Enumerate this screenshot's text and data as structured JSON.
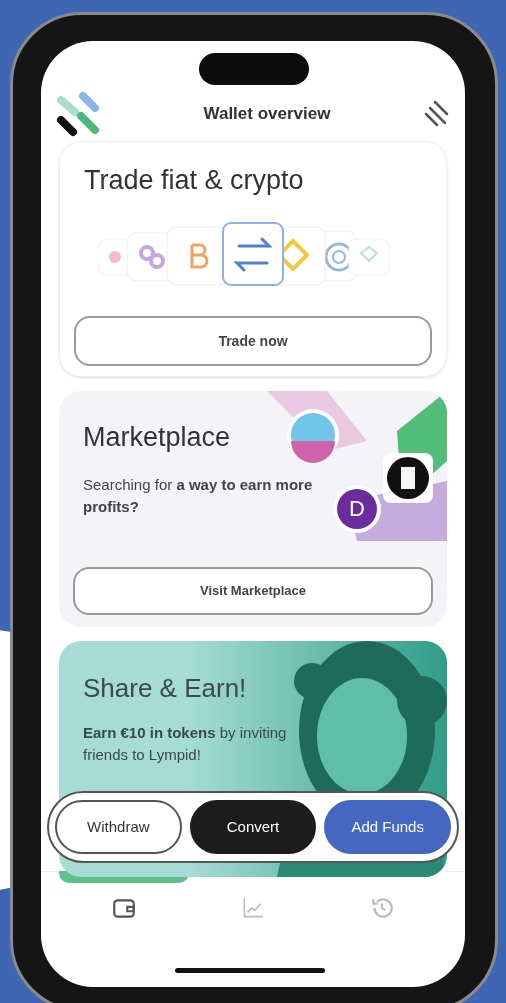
{
  "header": {
    "title": "Wallet overview"
  },
  "trade_card": {
    "title": "Trade fiat & crypto",
    "button": "Trade now"
  },
  "marketplace_card": {
    "title": "Marketplace",
    "text": "Searching for **a way to earn more profits?**",
    "token_letter": "D",
    "button": "Visit Marketplace"
  },
  "share_card": {
    "title": "Share & Earn!",
    "text": "**Earn €10 in tokens** by inviting friends to Lympid!"
  },
  "actions": [
    {
      "label": "Withdraw",
      "kind": "outline"
    },
    {
      "label": "Convert",
      "kind": "dark"
    },
    {
      "label": "Add Funds",
      "kind": "primary"
    }
  ],
  "nav": [
    {
      "kind": "wallet",
      "selected": true
    },
    {
      "kind": "chart",
      "selected": false
    },
    {
      "kind": "history",
      "selected": false
    }
  ]
}
